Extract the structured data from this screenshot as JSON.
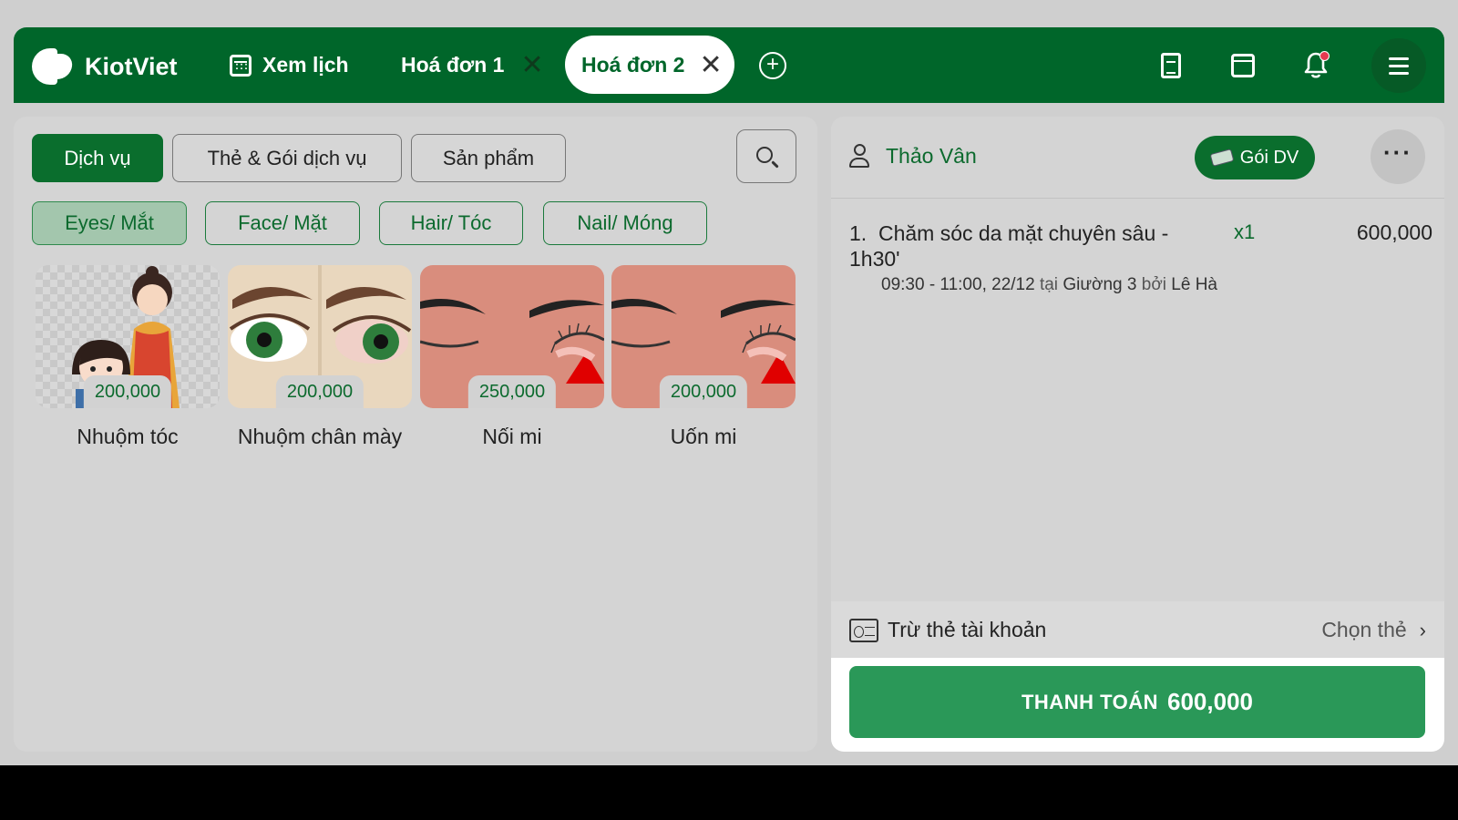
{
  "app": {
    "name": "KiotViet"
  },
  "tabs": {
    "schedule": "Xem lịch",
    "invoice1": "Hoá đơn 1",
    "invoice2": "Hoá đơn 2",
    "close_glyph": "✕",
    "add_glyph": "+"
  },
  "header_icons": [
    "document-icon",
    "calendar-edit-icon",
    "bell-icon",
    "menu-icon"
  ],
  "catalog_tabs": {
    "services": "Dịch vụ",
    "cards_packages": "Thẻ & Gói dịch vụ",
    "products": "Sản phẩm"
  },
  "categories": {
    "eyes": "Eyes/ Mắt",
    "face": "Face/ Mặt",
    "hair": "Hair/ Tóc",
    "nail": "Nail/ Móng"
  },
  "products": [
    {
      "name": "Nhuộm tóc",
      "price": "200,000"
    },
    {
      "name": "Nhuộm chân mày",
      "price": "200,000"
    },
    {
      "name": "Nối mi",
      "price": "250,000"
    },
    {
      "name": "Uốn mi",
      "price": "200,000"
    }
  ],
  "order": {
    "customer": "Thảo Vân",
    "package_button": "Gói DV",
    "more_glyph": "···",
    "item": {
      "index": "1.",
      "title": "Chăm sóc da mặt chuyên sâu - 1h30'",
      "qty": "x1",
      "price": "600,000",
      "time": "09:30 - 11:00, 22/12",
      "at_word": "tại",
      "location": "Giường 3",
      "by_word": "bởi",
      "staff": "Lê Hà"
    },
    "deduct_label": "Trừ thẻ tài khoản",
    "choose_card": "Chọn thẻ",
    "chevron": "›",
    "pay_label": "THANH TOÁN",
    "pay_amount": "600,000"
  },
  "colors": {
    "brand_green": "#00662a",
    "pay_green": "#2a9858",
    "notification_dot": "#e53950"
  }
}
